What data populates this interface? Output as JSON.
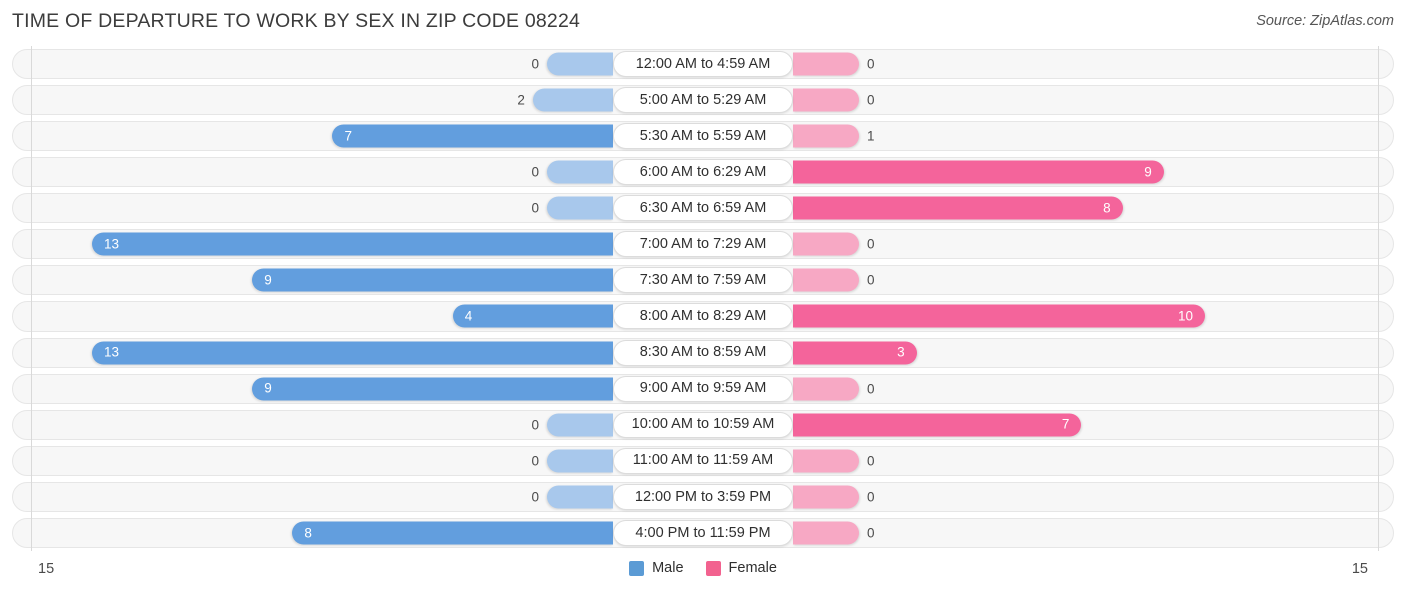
{
  "header": {
    "title": "TIME OF DEPARTURE TO WORK BY SEX IN ZIP CODE 08224",
    "source": "Source: ZipAtlas.com"
  },
  "legend": {
    "male_label": "Male",
    "female_label": "Female",
    "male_color": "#5B9BD5",
    "female_color": "#F2628F"
  },
  "axis": {
    "left_tick": "15",
    "right_tick": "15"
  },
  "colors": {
    "male_strong": "#629EDE",
    "male_light": "#A8C8EC",
    "female_strong": "#F4649B",
    "female_light": "#F7A8C4"
  },
  "chart_data": {
    "type": "bar",
    "orientation": "horizontal-diverging",
    "title": "TIME OF DEPARTURE TO WORK BY SEX IN ZIP CODE 08224",
    "xlabel": "",
    "ylabel": "",
    "xlim": [
      15,
      15
    ],
    "grid": true,
    "legend_position": "bottom-center",
    "categories": [
      "12:00 AM to 4:59 AM",
      "5:00 AM to 5:29 AM",
      "5:30 AM to 5:59 AM",
      "6:00 AM to 6:29 AM",
      "6:30 AM to 6:59 AM",
      "7:00 AM to 7:29 AM",
      "7:30 AM to 7:59 AM",
      "8:00 AM to 8:29 AM",
      "8:30 AM to 8:59 AM",
      "9:00 AM to 9:59 AM",
      "10:00 AM to 10:59 AM",
      "11:00 AM to 11:59 AM",
      "12:00 PM to 3:59 PM",
      "4:00 PM to 11:59 PM"
    ],
    "series": [
      {
        "name": "Male",
        "values": [
          0,
          2,
          7,
          0,
          0,
          13,
          9,
          4,
          13,
          9,
          0,
          0,
          0,
          8
        ]
      },
      {
        "name": "Female",
        "values": [
          0,
          0,
          1,
          9,
          8,
          0,
          0,
          10,
          3,
          0,
          7,
          0,
          0,
          0
        ]
      }
    ]
  },
  "rows": [
    {
      "label": "12:00 AM to 4:59 AM",
      "male": "0",
      "female": "0"
    },
    {
      "label": "5:00 AM to 5:29 AM",
      "male": "2",
      "female": "0"
    },
    {
      "label": "5:30 AM to 5:59 AM",
      "male": "7",
      "female": "1"
    },
    {
      "label": "6:00 AM to 6:29 AM",
      "male": "0",
      "female": "9"
    },
    {
      "label": "6:30 AM to 6:59 AM",
      "male": "0",
      "female": "8"
    },
    {
      "label": "7:00 AM to 7:29 AM",
      "male": "13",
      "female": "0"
    },
    {
      "label": "7:30 AM to 7:59 AM",
      "male": "9",
      "female": "0"
    },
    {
      "label": "8:00 AM to 8:29 AM",
      "male": "4",
      "female": "10"
    },
    {
      "label": "8:30 AM to 8:59 AM",
      "male": "13",
      "female": "3"
    },
    {
      "label": "9:00 AM to 9:59 AM",
      "male": "9",
      "female": "0"
    },
    {
      "label": "10:00 AM to 10:59 AM",
      "male": "0",
      "female": "7"
    },
    {
      "label": "11:00 AM to 11:59 AM",
      "male": "0",
      "female": "0"
    },
    {
      "label": "12:00 PM to 3:59 PM",
      "male": "0",
      "female": "0"
    },
    {
      "label": "4:00 PM to 11:59 PM",
      "male": "8",
      "female": "0"
    }
  ]
}
